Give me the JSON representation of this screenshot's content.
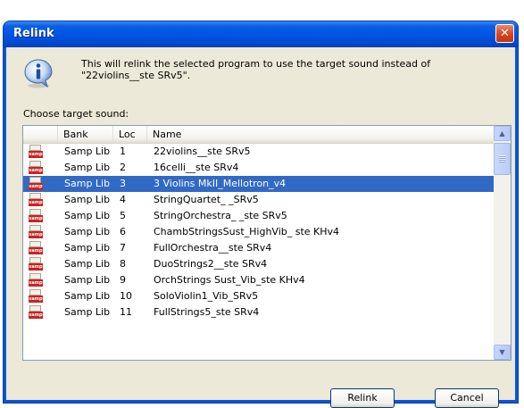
{
  "window": {
    "title": "Relink",
    "close_glyph": "✕"
  },
  "icons": {
    "info": "info-icon",
    "close": "close-icon",
    "program": "sampler-program-icon"
  },
  "message": {
    "line1": "This will relink the selected program to use the target sound instead of",
    "line2": "\"22violins__ste SRv5\"."
  },
  "choose_label": "Choose target sound:",
  "table": {
    "columns": [
      "",
      "Bank",
      "Loc",
      "Name"
    ],
    "rows": [
      {
        "bank": "Samp Lib",
        "loc": "1",
        "name": "22violins__ste SRv5"
      },
      {
        "bank": "Samp Lib",
        "loc": "2",
        "name": "16celli__ste SRv4"
      },
      {
        "bank": "Samp Lib",
        "loc": "3",
        "name": "3 Violins MkII_Mellotron_v4",
        "selected": true
      },
      {
        "bank": "Samp Lib",
        "loc": "4",
        "name": "StringQuartet_ _SRv5"
      },
      {
        "bank": "Samp Lib",
        "loc": "5",
        "name": "StringOrchestra_ _ste SRv5"
      },
      {
        "bank": "Samp Lib",
        "loc": "6",
        "name": "ChambStringsSust_HighVib_ ste KHv4"
      },
      {
        "bank": "Samp Lib",
        "loc": "7",
        "name": "FullOrchestra__ste SRv4"
      },
      {
        "bank": "Samp Lib",
        "loc": "8",
        "name": "DuoStrings2__ste SRv4"
      },
      {
        "bank": "Samp Lib",
        "loc": "9",
        "name": "OrchStrings Sust_Vib_ste KHv4"
      },
      {
        "bank": "Samp Lib",
        "loc": "10",
        "name": "SoloViolin1_Vib_SRv5"
      },
      {
        "bank": "Samp Lib",
        "loc": "11",
        "name": "FullStrings5_ste SRv4"
      }
    ],
    "icon_label": "samp"
  },
  "buttons": {
    "relink": "Relink",
    "cancel": "Cancel"
  },
  "colors": {
    "selection": "#316ac5",
    "titlebar": "#0055e5",
    "dialog_bg": "#ece9d8"
  }
}
